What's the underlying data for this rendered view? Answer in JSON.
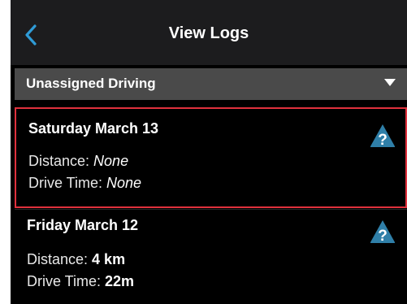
{
  "header": {
    "title": "View Logs",
    "back_icon": "chevron-left-icon",
    "accent_color": "#2f9bd6"
  },
  "filter": {
    "selected": "Unassigned Driving",
    "icon": "caret-down-icon"
  },
  "logs": [
    {
      "date": "Saturday March 13",
      "distance_label": "Distance: ",
      "distance_value": "None",
      "drive_time_label": "Drive Time: ",
      "drive_time_value": "None",
      "status_icon": "unknown-status-icon",
      "selected": true
    },
    {
      "date": "Friday March 12",
      "distance_label": "Distance: ",
      "distance_value": "4 km",
      "drive_time_label": "Drive Time: ",
      "drive_time_value": "22m",
      "status_icon": "unknown-status-icon",
      "selected": false
    }
  ],
  "colors": {
    "background": "#000000",
    "navbar": "#1c1c1e",
    "filter_bar": "#4a4a4a",
    "selection_border": "#e0313d",
    "warning_icon": "#2f7fa8"
  }
}
